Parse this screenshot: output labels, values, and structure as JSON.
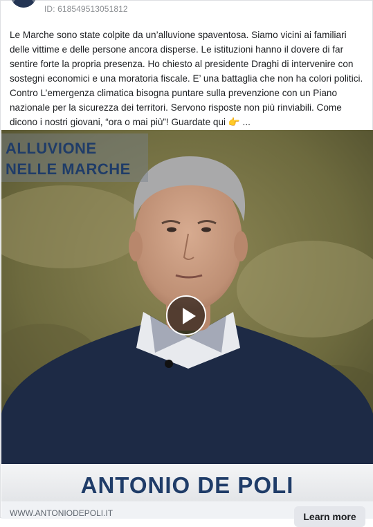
{
  "ad": {
    "id_text": "ID: 618549513051812",
    "body": "Le Marche sono state colpite da un’alluvione spaventosa. Siamo vicini ai familiari delle vittime e delle persone ancora disperse. Le istituzioni hanno il dovere di far sentire forte la propria presenza. Ho chiesto al presidente Draghi di intervenire con sostegni economici e una moratoria fiscale. E’ una battaglia che non ha colori politici. Contro L’emergenza climatica bisogna puntare sulla prevenzione con un Piano nazionale per la sicurezza dei territori. Servono risposte non più rinviabili. Come dicono i nostri giovani, “ora o mai più”! Guardate qui 👉 ..."
  },
  "video": {
    "overlay_line1": "ALLUVIONE",
    "overlay_line2": "NELLE MARCHE",
    "name_banner": "ANTONIO DE POLI"
  },
  "cta": {
    "domain": "WWW.ANTONIODEPOLI.IT",
    "button_label": "Learn more"
  },
  "colors": {
    "overlay_text": "#1f3c68",
    "link_text": "#606770"
  }
}
